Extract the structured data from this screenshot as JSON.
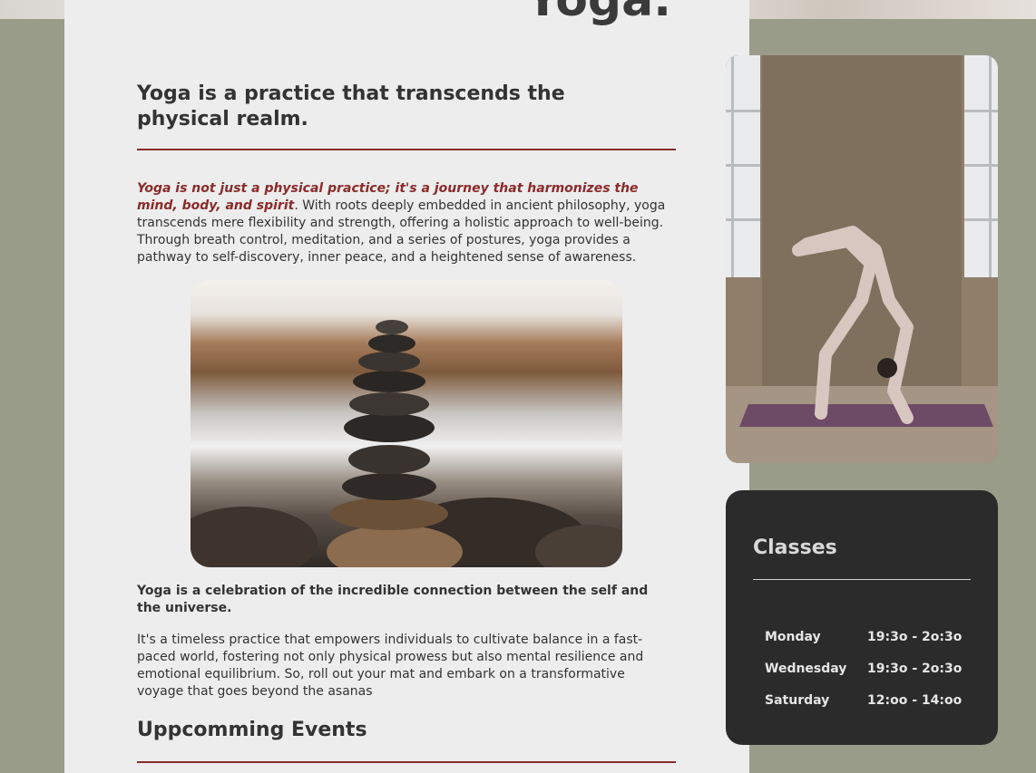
{
  "page": {
    "title": "Yoga."
  },
  "intro": {
    "heading": "Yoga is a practice that transcends the physical realm.",
    "emphasis": "Yoga is not just a physical practice; it's a journey that harmonizes the mind, body, and spirit",
    "body": ". With roots deeply embedded in ancient philosophy, yoga transcends mere flexibility and strength, offering a holistic approach to well-being. Through breath control, meditation, and a series of postures, yoga provides a pathway to self-discovery, inner peace, and a heightened sense of awareness."
  },
  "celebration": "Yoga is a celebration of the incredible connection between the self and the universe.",
  "timeless": "It's a timeless practice that empowers individuals to cultivate balance in a fast-paced world, fostering not only physical prowess but also mental resilience and emotional equilibrium. So, roll out your mat and embark on a transformative voyage that goes beyond the asanas",
  "events": {
    "heading": "Uppcomming Events"
  },
  "classes": {
    "title": "Classes",
    "schedule": [
      {
        "day": "Monday",
        "time": "19:3o - 2o:3o"
      },
      {
        "day": "Wednesday",
        "time": "19:3o - 2o:3o"
      },
      {
        "day": "Saturday",
        "time": "12:oo - 14:oo"
      }
    ]
  },
  "colors": {
    "background": "#9a9c8a",
    "card": "#ededed",
    "accent": "#8b2a2a",
    "dark_card": "#2b2b2b"
  }
}
